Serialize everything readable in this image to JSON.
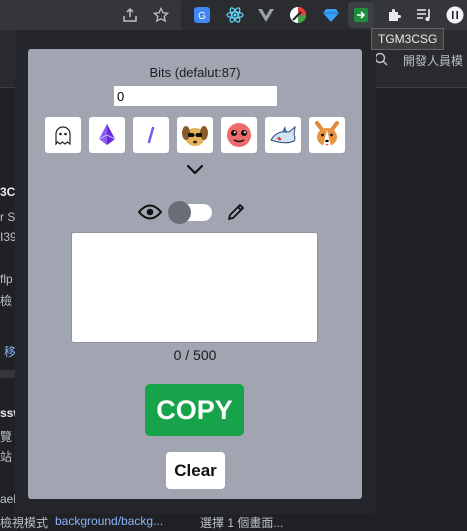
{
  "tooltip": {
    "text": "TGM3CSG"
  },
  "toolbar": {
    "icons": [
      "share-icon",
      "star-icon",
      "translate-icon",
      "react-icon",
      "vue-icon",
      "color-extension-icon",
      "gem-icon",
      "tgm-extension-icon",
      "extensions-puzzle-icon",
      "media-controls-icon",
      "profile-icon"
    ]
  },
  "background_page": {
    "right_label": "開發人員模",
    "fragments": [
      "3C",
      "r S",
      "I39",
      "flp",
      "檢",
      "移",
      "ssw",
      "覽",
      "站",
      "aeb",
      "檢視模式"
    ],
    "link_text": "background/backg...",
    "trailing_text": "選擇 1 個畫面..."
  },
  "popup": {
    "bits_label": "Bits (defalut:87)",
    "bits_value": "0",
    "emotes": [
      "ghost-emote",
      "purple-gem-emote",
      "slash-emote",
      "dog-with-glasses-emote",
      "red-blob-emote",
      "shark-emote",
      "corgi-emote"
    ],
    "message_value": "",
    "counter": "0 / 500",
    "copy_label": "COPY",
    "clear_label": "Clear",
    "accent_color": "#16a34a",
    "card_color": "#a0a5b1"
  }
}
